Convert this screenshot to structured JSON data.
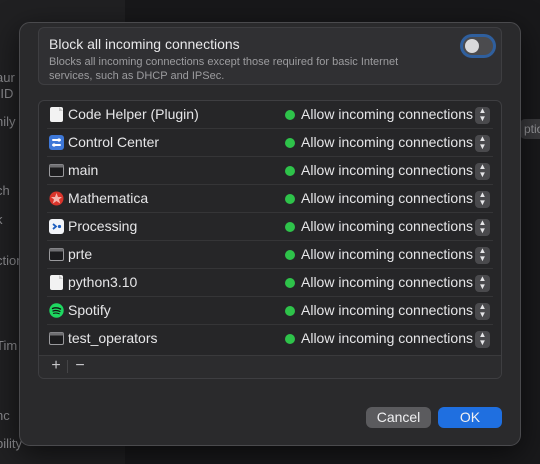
{
  "background": {
    "left_fragments": [
      "aur",
      "-ID",
      "nily",
      "ch",
      "k",
      "ction",
      "Tim",
      "nc",
      "bility"
    ],
    "right_fragment": "ptio"
  },
  "block_all": {
    "title": "Block all incoming connections",
    "description": "Blocks all incoming connections except those required for basic Internet services, such as DHCP and IPSec.",
    "enabled": false
  },
  "apps": [
    {
      "name": "Code Helper (Plugin)",
      "icon": "document-icon",
      "status": "Allow incoming connections"
    },
    {
      "name": "Control Center",
      "icon": "control-center-icon",
      "status": "Allow incoming connections"
    },
    {
      "name": "main",
      "icon": "terminal-exec-icon",
      "status": "Allow incoming connections"
    },
    {
      "name": "Mathematica",
      "icon": "mathematica-icon",
      "status": "Allow incoming connections"
    },
    {
      "name": "Processing",
      "icon": "processing-icon",
      "status": "Allow incoming connections"
    },
    {
      "name": "prte",
      "icon": "terminal-exec-icon",
      "status": "Allow incoming connections"
    },
    {
      "name": "python3.10",
      "icon": "document-icon",
      "status": "Allow incoming connections"
    },
    {
      "name": "Spotify",
      "icon": "spotify-icon",
      "status": "Allow incoming connections"
    },
    {
      "name": "test_operators",
      "icon": "terminal-exec-icon",
      "status": "Allow incoming connections"
    }
  ],
  "footer": {
    "add": "+",
    "remove": "−"
  },
  "buttons": {
    "cancel": "Cancel",
    "ok": "OK"
  },
  "colors": {
    "status_green": "#2ec34a",
    "accent": "#1f6fe0"
  }
}
